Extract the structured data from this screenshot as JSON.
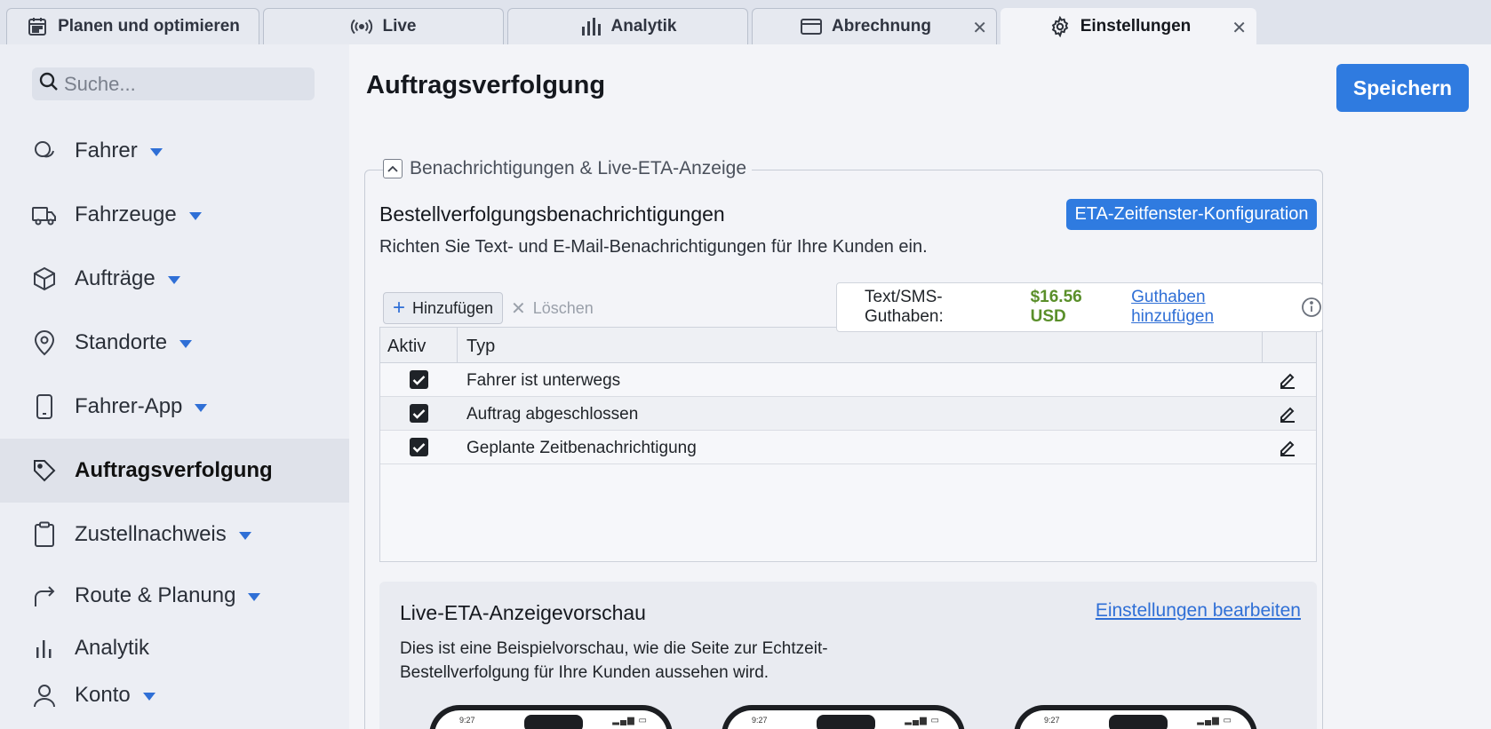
{
  "tabs": [
    {
      "label": "Planen und optimieren",
      "icon": "calendar-icon"
    },
    {
      "label": "Live",
      "icon": "broadcast-icon"
    },
    {
      "label": "Analytik",
      "icon": "bar-chart-icon"
    },
    {
      "label": "Abrechnung",
      "icon": "credit-card-icon",
      "closable": true
    },
    {
      "label": "Einstellungen",
      "icon": "gear-icon",
      "closable": true,
      "active": true
    }
  ],
  "sidebar": {
    "search_placeholder": "Suche...",
    "items": [
      {
        "label": "Fahrer",
        "icon": "users-icon",
        "has_caret": true
      },
      {
        "label": "Fahrzeuge",
        "icon": "truck-icon",
        "has_caret": true
      },
      {
        "label": "Aufträge",
        "icon": "box-icon",
        "has_caret": true
      },
      {
        "label": "Standorte",
        "icon": "map-pin-icon",
        "has_caret": true
      },
      {
        "label": "Fahrer-App",
        "icon": "smartphone-icon",
        "has_caret": true
      },
      {
        "label": "Auftragsverfolgung",
        "icon": "tag-icon",
        "has_caret": false,
        "active": true
      },
      {
        "label": "Zustellnachweis",
        "icon": "clipboard-icon",
        "has_caret": true
      },
      {
        "label": "Route & Planung",
        "icon": "share-arrow-icon",
        "has_caret": true
      },
      {
        "label": "Analytik",
        "icon": "bar-chart-icon",
        "has_caret": false
      },
      {
        "label": "Konto",
        "icon": "user-icon",
        "has_caret": true
      }
    ]
  },
  "main": {
    "title": "Auftragsverfolgung",
    "save_label": "Speichern",
    "section_legend": "Benachrichtigungen & Live-ETA-Anzeige",
    "notifications": {
      "title": "Bestellverfolgungsbenachrichtigungen",
      "description": "Richten Sie Text- und E-Mail-Benachrichtigungen für Ihre Kunden ein.",
      "eta_button": "ETA-Zeitfenster-Konfiguration",
      "add_label": "Hinzufügen",
      "delete_label": "Löschen",
      "credit_label": "Text/SMS-Guthaben:",
      "credit_value": "$16.56 USD",
      "credit_link": "Guthaben hinzufügen",
      "columns": [
        "Aktiv",
        "Typ"
      ],
      "rows": [
        {
          "active": true,
          "type": "Fahrer ist unterwegs"
        },
        {
          "active": true,
          "type": "Auftrag abgeschlossen"
        },
        {
          "active": true,
          "type": "Geplante Zeitbenachrichtigung"
        }
      ]
    },
    "preview": {
      "title": "Live-ETA-Anzeigevorschau",
      "edit_link": "Einstellungen bearbeiten",
      "description": "Dies ist eine Beispielvorschau, wie die Seite zur Echtzeit-Bestellverfolgung für Ihre Kunden aussehen wird.",
      "phone_time": "9:27"
    }
  },
  "colors": {
    "accent": "#2f7be0",
    "link": "#2f6fd6",
    "credit_value": "#5a8f2a"
  }
}
